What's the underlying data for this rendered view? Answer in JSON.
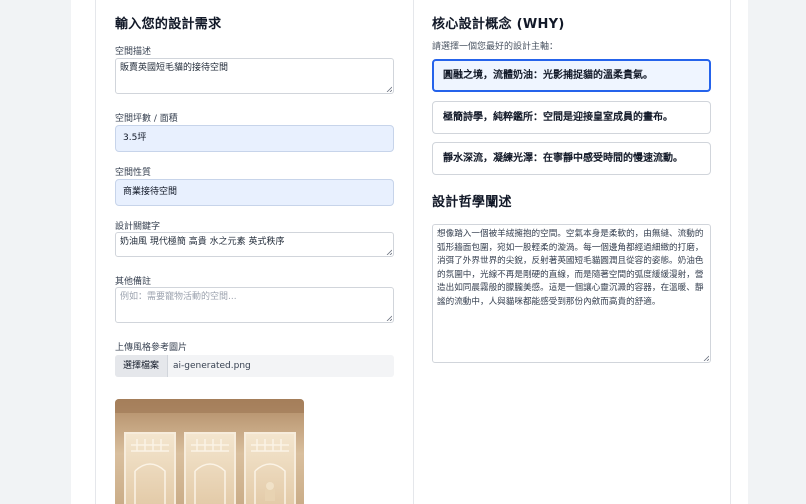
{
  "left": {
    "title": "輸入您的設計需求",
    "space_description": {
      "label": "空間描述",
      "value": "販賣英國短毛貓的接待空間"
    },
    "area": {
      "label": "空間坪數 / 面積",
      "value": "3.5坪"
    },
    "nature": {
      "label": "空間性質",
      "value": "商業接待空間"
    },
    "keywords": {
      "label": "設計關鍵字",
      "value": "奶油風 現代極簡 高貴 水之元素 英式秩序"
    },
    "notes": {
      "label": "其他備註",
      "value": "",
      "placeholder": "例如：需要寵物活動的空間..."
    },
    "upload": {
      "label": "上傳風格參考圖片",
      "button": "選擇檔案",
      "file_name": "ai-generated.png"
    }
  },
  "right": {
    "title": "核心設計概念 (WHY)",
    "hint": "請選擇一個您最好的設計主軸：",
    "options": [
      {
        "label": "圓融之境，流體奶油：光影捕捉貓的溫柔貴氣。",
        "selected": true
      },
      {
        "label": "極簡詩學，純粹鑑所：空間是迎接皇室成員的畫布。",
        "selected": false
      },
      {
        "label": "靜水深流，凝練光澤：在寧靜中感受時間的慢速流動。",
        "selected": false
      }
    ],
    "philosophy_title": "設計哲學闡述",
    "philosophy_text": "想像踏入一個被羊絨擁抱的空間。空氣本身是柔軟的，由無縫、流動的弧形牆面包圍，宛如一股輕柔的漩渦。每一個邊角都經過細緻的打磨，消弭了外界世界的尖銳，反射著英國短毛貓圓潤且從容的姿態。奶油色的氛圍中，光線不再是剛硬的直線，而是隨著空間的弧度緩緩漫射，營造出如同晨霧般的朦朧美感。這是一個讓心靈沉澱的容器，在溫暖、靜謐的流動中，人與貓咪都能感受到那份內斂而高貴的舒適。"
  },
  "colors": {
    "accent": "#2563eb",
    "filled_input": "#e8f0fe"
  }
}
